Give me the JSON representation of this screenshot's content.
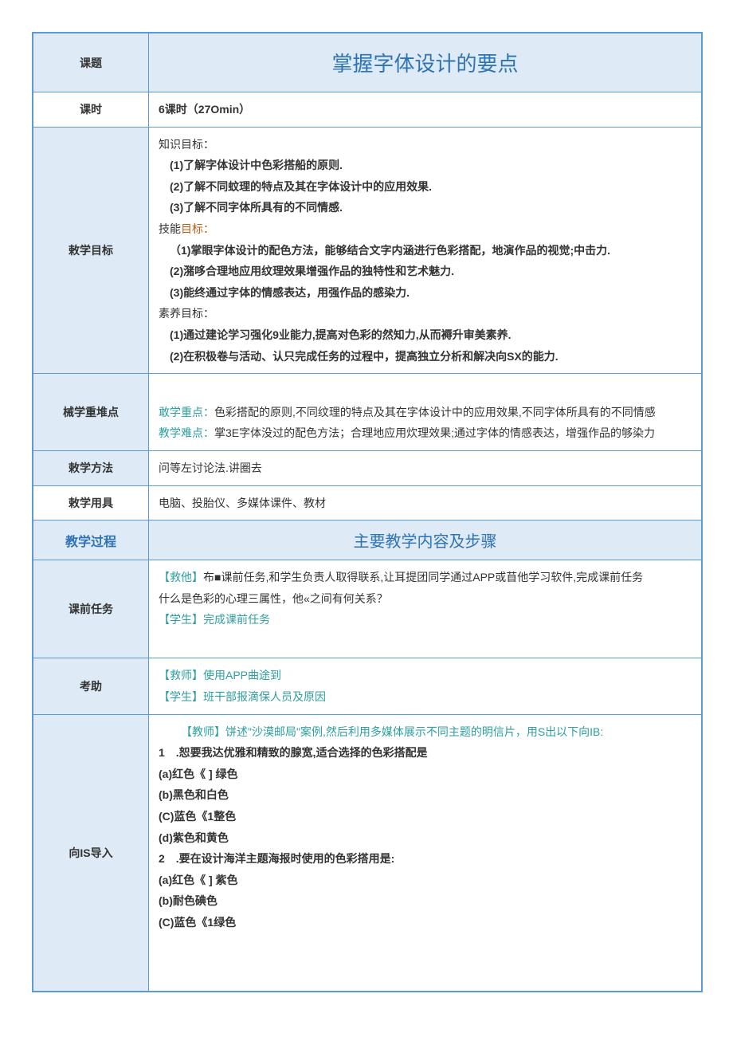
{
  "header": {
    "topic_label": "课题",
    "topic_title": "掌握字体设计的要点",
    "period_label": "课时",
    "period_value": "6课时（27Omin）"
  },
  "goals": {
    "label": "敕学目标",
    "knowledge_heading": "知识目标：",
    "k1": "(1)了解字体设计中色彩搭船的原则.",
    "k2": "(2)了解不同蚊理的特点及其在字体设计中的应用效果.",
    "k3": "(3)了解不同字体所具有的不同情感.",
    "skill_heading_a": "技能",
    "skill_heading_b": "目标：",
    "s1": "（1)掌眼字体设计的配色方法，能够结合文字内涵进行色彩搭配，地演作品的视觉;中击力.",
    "s2": "(2)潴哆合理地应用纹理效果增强作品的独特性和艺术魅力.",
    "s3": "(3)能终通过字体的情感表达，用强作品的感染力.",
    "quality_heading": "素养目标：",
    "q1": "(1)通过建论学习强化9业能力,提高对色彩的然知力,从而褥升审美素养.",
    "q2": "(2)在积极卷与活动、认只完成任务的过程中，提高独立分析和解决向SX的能力."
  },
  "keypoints": {
    "label": "械学重堆点",
    "key_prefix": "敢学重点：",
    "key_text": "色彩搭配的原则,不同纹理的特点及其在字体设计中的应用效果,不同字体所具有的不同情感",
    "diff_prefix": "教学难点：",
    "diff_text": "掌3E字体没过的配色方法；合理地应用炊理效果;通过字体的情感表达，增强作品的够染力"
  },
  "method": {
    "label": "敕学方法",
    "value": "问等左讨论法.讲圈去"
  },
  "tools": {
    "label": "敕学用具",
    "value": "电脑、投胎仪、多媒体课件、教材"
  },
  "process": {
    "left": "教学过程",
    "right": "主要教学内容及步骤"
  },
  "pretask": {
    "label": "课前任务",
    "t1a": "【救他】",
    "t1b": "布■课前任务,和学生负责人取得联系,让耳提团同学通过APP或苜他学习软件,完成课前任务",
    "t2": "什么是色彩的心理三属性，他«之间有何关系？",
    "t3": "【学生】完成课前任务"
  },
  "check": {
    "label": "考助",
    "c1": "【救师】使用APP曲途到",
    "c2": "【学生】班干部报滴保人员及原因"
  },
  "intro": {
    "label": "向IS导入",
    "lead": "【教师】饼述\"沙漠邮局\"案例,然后利用多媒体展示不同主题的明信片，用S出以下向IB:",
    "q1": "1　.恕要我达优雅和精致的腺宽,适合选择的色彩搭配是",
    "q1a": "(a)红色《 ] 绿色",
    "q1b": "(b)黑色和白色",
    "q1c": "(C)蓝色《1整色",
    "q1d": "(d)紫色和黄色",
    "q2": "2　.要在设计海洋主题海报时使用的色彩搭用是:",
    "q2a": "(a)红色《 ] 紫色",
    "q2b": "(b)耐色碘色",
    "q2c": "(C)蓝色《1绿色"
  }
}
